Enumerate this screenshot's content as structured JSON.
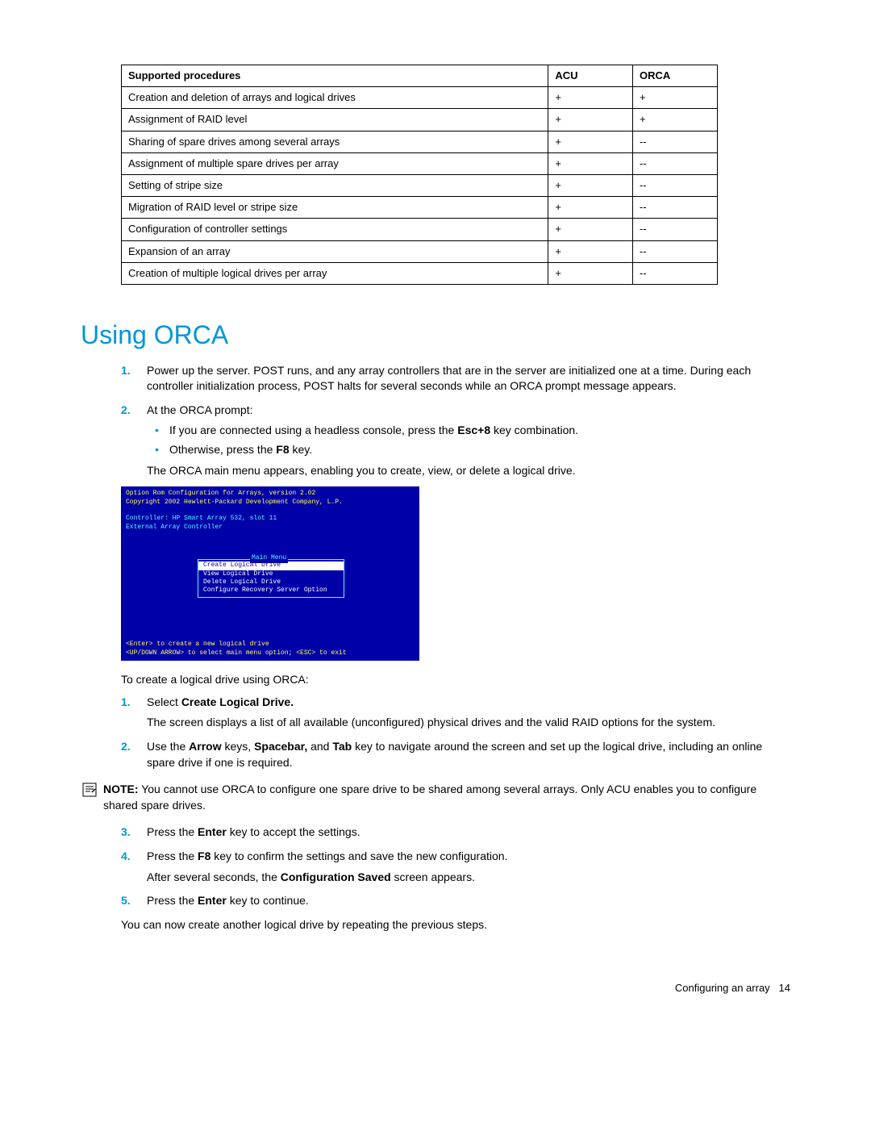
{
  "table": {
    "headers": {
      "proc": "Supported procedures",
      "acu": "ACU",
      "orca": "ORCA"
    },
    "rows": [
      {
        "proc": "Creation and deletion of arrays and logical drives",
        "acu": "+",
        "orca": "+"
      },
      {
        "proc": "Assignment of RAID level",
        "acu": "+",
        "orca": "+"
      },
      {
        "proc": "Sharing of spare drives among several arrays",
        "acu": "+",
        "orca": "--"
      },
      {
        "proc": "Assignment of multiple spare drives per array",
        "acu": "+",
        "orca": "--"
      },
      {
        "proc": "Setting of stripe size",
        "acu": "+",
        "orca": "--"
      },
      {
        "proc": "Migration of RAID level or stripe size",
        "acu": "+",
        "orca": "--"
      },
      {
        "proc": "Configuration of controller settings",
        "acu": "+",
        "orca": "--"
      },
      {
        "proc": "Expansion of an array",
        "acu": "+",
        "orca": "--"
      },
      {
        "proc": "Creation of multiple logical drives per array",
        "acu": "+",
        "orca": "--"
      }
    ]
  },
  "heading": "Using ORCA",
  "step1_text": "Power up the server. POST runs, and any array controllers that are in the server are initialized one at a time. During each controller initialization process, POST halts for several seconds while an ORCA prompt message appears.",
  "step2_lead": "At the ORCA prompt:",
  "step2_b1_a": "If you are connected using a headless console, press the ",
  "step2_b1_bold": "Esc+8",
  "step2_b1_b": " key combination.",
  "step2_b2_a": "Otherwise, press the ",
  "step2_b2_bold": "F8",
  "step2_b2_b": " key.",
  "step2_after": "The ORCA main menu appears, enabling you to create, view, or delete a logical drive.",
  "shot": {
    "line1": "Option Rom Configuration for Arrays, version  2.02",
    "line2": "Copyright 2002 Hewlett-Packard Development Company, L.P.",
    "line3": "Controller: HP Smart Array 532, slot 11",
    "line4": "External Array Controller",
    "menu_title": "Main Menu",
    "m1": "Create Logical Drive",
    "m2": "View Logical Drive",
    "m3": "Delete Logical Drive",
    "m4": "Configure Recovery Server Option",
    "bot1": "<Enter> to create a new logical drive",
    "bot2": "<UP/DOWN ARROW> to select main menu option; <ESC> to exit"
  },
  "create_intro": "To create a logical drive using ORCA:",
  "c1_a": "Select ",
  "c1_bold": "Create Logical Drive.",
  "c1_after": "The screen displays a list of all available (unconfigured) physical drives and the valid RAID options for the system.",
  "c2_a": "Use the ",
  "c2_b1": "Arrow",
  "c2_mid1": " keys, ",
  "c2_b2": "Spacebar,",
  "c2_mid2": " and ",
  "c2_b3": "Tab",
  "c2_b": " key to navigate around the screen and set up the logical drive, including an online spare drive if one is required.",
  "note_label": "NOTE:",
  "note_text": "  You cannot use ORCA to configure one spare drive to be shared among several arrays. Only ACU enables you to configure shared spare drives.",
  "c3_a": "Press the ",
  "c3_bold": "Enter",
  "c3_b": " key to accept the settings.",
  "c4_a": "Press the ",
  "c4_bold": "F8",
  "c4_b": " key to confirm the settings and save the new configuration.",
  "c4_after_a": "After several seconds, the ",
  "c4_after_bold": "Configuration Saved",
  "c4_after_b": " screen appears.",
  "c5_a": "Press the ",
  "c5_bold": "Enter",
  "c5_b": " key to continue.",
  "closing": "You can now create another logical drive by repeating the previous steps.",
  "footer_text": "Configuring an array",
  "footer_page": "14"
}
